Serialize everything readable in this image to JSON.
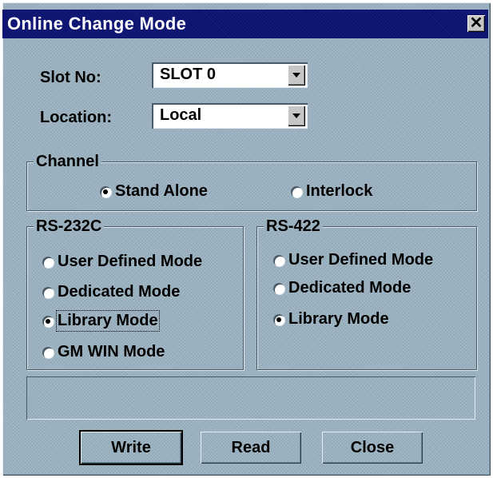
{
  "window": {
    "title": "Online Change Mode",
    "close_symbol": "✕"
  },
  "slot": {
    "label": "Slot No:",
    "value": "SLOT 0"
  },
  "location": {
    "label": "Location:",
    "value": "Local"
  },
  "channel": {
    "legend": "Channel",
    "options": [
      {
        "label": "Stand Alone",
        "selected": true
      },
      {
        "label": "Interlock",
        "selected": false
      }
    ]
  },
  "rs232c": {
    "legend": "RS-232C",
    "options": [
      {
        "label": "User Defined Mode",
        "selected": false
      },
      {
        "label": "Dedicated Mode",
        "selected": false
      },
      {
        "label": "Library Mode",
        "selected": true
      },
      {
        "label": "GM WIN Mode",
        "selected": false
      }
    ]
  },
  "rs422": {
    "legend": "RS-422",
    "options": [
      {
        "label": "User Defined Mode",
        "selected": false
      },
      {
        "label": "Dedicated Mode",
        "selected": false
      },
      {
        "label": "Library Mode",
        "selected": true
      }
    ]
  },
  "buttons": {
    "write": "Write",
    "read": "Read",
    "close": "Close"
  },
  "colors": {
    "titlebar": "#0b1270",
    "dialog_bg": "#9bb2c1"
  }
}
